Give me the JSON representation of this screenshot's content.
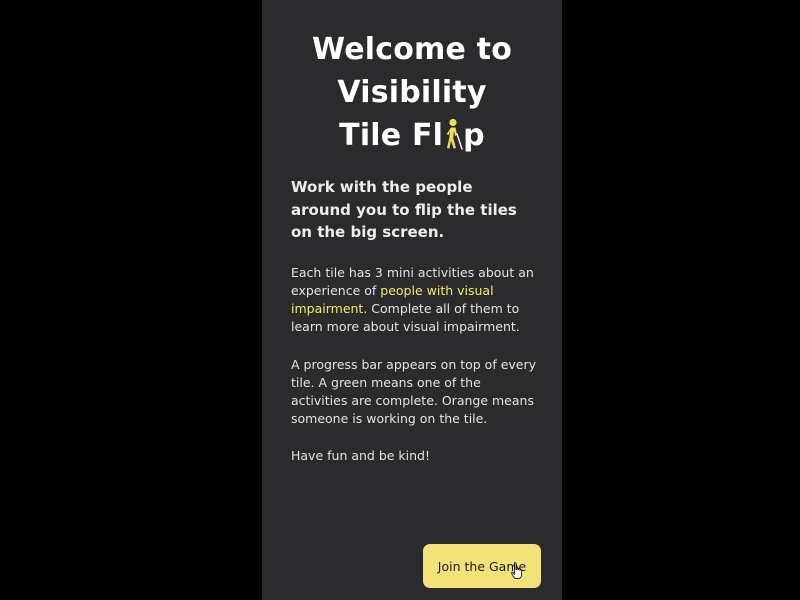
{
  "title": {
    "line1": "Welcome to",
    "line2": "Visibility",
    "line3_prefix": "Tile Fl",
    "line3_icon": "walking-person-icon",
    "line3_suffix": "p"
  },
  "lead": "Work with the people around you to flip the tiles on the big screen.",
  "paragraph1": {
    "before": "Each tile has 3 mini activities about an experience of ",
    "highlight": "people with visual impairment.",
    "after": " Complete all of them to learn more about visual impairment."
  },
  "paragraph2": "A progress bar appears on top of every tile. A green means one of the activities are complete. Orange means someone is working on the tile.",
  "paragraph3": "Have fun and be kind!",
  "join_button": {
    "label": "Join the Game"
  },
  "colors": {
    "page_background": "#000000",
    "panel_background": "#2b2b2e",
    "accent_yellow": "#f5e96a",
    "button_background": "#f3e27a",
    "icon_yellow": "#f2dc55"
  },
  "icons": {
    "title_icon": "walking-person-icon",
    "pointer": "hand-pointer-cursor-icon"
  }
}
